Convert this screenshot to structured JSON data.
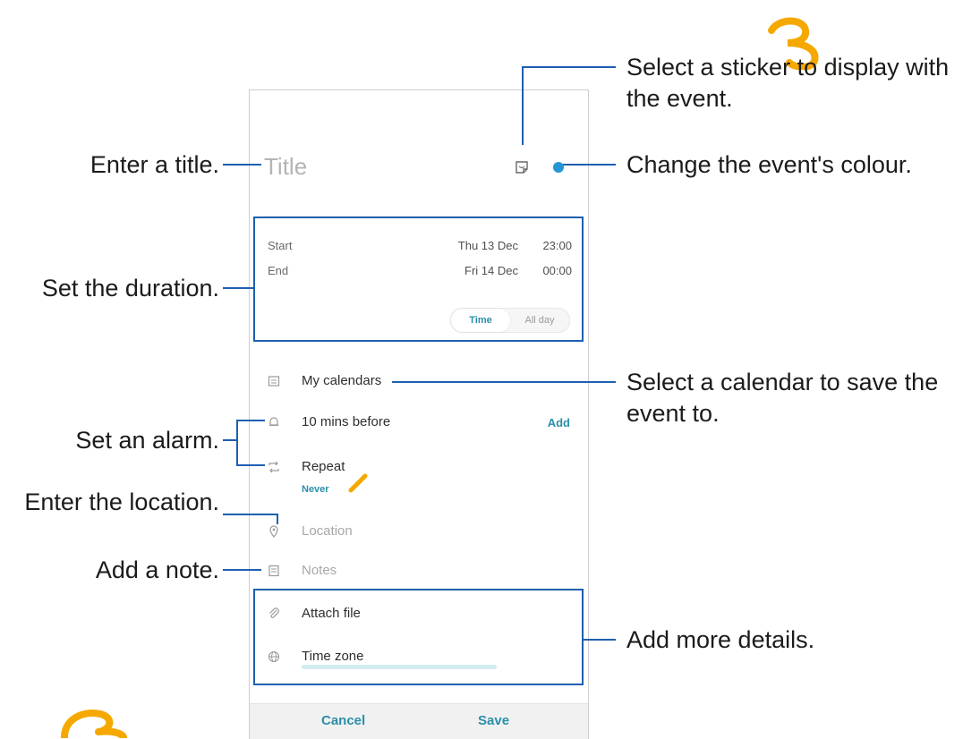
{
  "form": {
    "title_placeholder": "Title",
    "start_label": "Start",
    "start_date": "Thu 13 Dec",
    "start_time": "23:00",
    "end_label": "End",
    "end_date": "Fri 14 Dec",
    "end_time": "00:00",
    "toggle_time": "Time",
    "toggle_all_day": "All day",
    "calendar": "My calendars",
    "alarm": "10 mins before",
    "alarm_add": "Add",
    "repeat": "Repeat",
    "repeat_value": "Never",
    "location_placeholder": "Location",
    "notes_placeholder": "Notes",
    "attach_file": "Attach file",
    "time_zone": "Time zone",
    "cancel": "Cancel",
    "save": "Save"
  },
  "callouts": {
    "sticker": "Select a sticker to display with",
    "sticker_2": "the event.",
    "colour": "Change the event's colour.",
    "title": "Enter a title.",
    "duration": "Set the duration.",
    "calendar": "Select a calendar to save the",
    "calendar_2": "event to.",
    "alarm": "Set an alarm.",
    "location": "Enter the location.",
    "note": "Add a note.",
    "details": "Add more details."
  },
  "colors": {
    "accent": "#2a8fa8",
    "event_colour": "#2496d3",
    "callout_line": "#1f5fb0",
    "decoration": "#f5a800"
  },
  "icons": [
    "sticker-icon",
    "color-dot",
    "calendar-icon",
    "bell-icon",
    "repeat-icon",
    "location-icon",
    "notes-icon",
    "paperclip-icon",
    "globe-icon",
    "pencil-icon"
  ]
}
